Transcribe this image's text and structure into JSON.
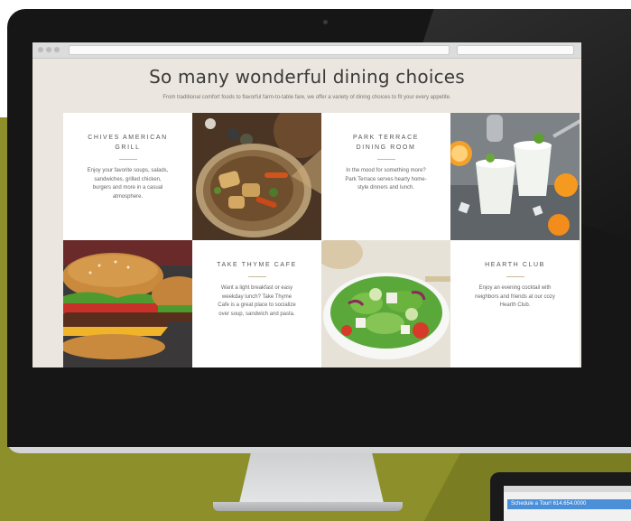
{
  "website": {
    "heading": "So many wonderful dining choices",
    "subheading": "From traditional comfort foods to flavorful farm-to-table fare, we offer a variety of dining choices to fit your every appetite."
  },
  "venues": [
    {
      "name": "CHIVES AMERICAN GRILL",
      "description": "Enjoy your favorite soups, salads, sandwiches, grilled chicken, burgers and more in a casual atmosphere."
    },
    {
      "name": "PARK TERRACE DINING ROOM",
      "description": "In the mood for something more? Park Terrace serves hearty home-style dinners and lunch."
    },
    {
      "name": "TAKE THYME CAFE",
      "description": "Want a light breakfast or easy weekday lunch? Take Thyme Cafe is a great place to socialize over soup, sandwich and pasta."
    },
    {
      "name": "HEARTH CLUB",
      "description": "Enjoy an evening cocktail with neighbors and friends at our cozy Hearth Club."
    }
  ],
  "images": [
    {
      "icon": "stew-dish-image"
    },
    {
      "icon": "cocktails-image"
    },
    {
      "icon": "burger-image"
    },
    {
      "icon": "salad-image"
    }
  ],
  "second_device": {
    "banner": "Schedule a Tour! 614.654.0000"
  },
  "colors": {
    "background_olive": "#8c8f2a",
    "bezel": "#161616",
    "page_bg": "#ebe6df",
    "accent_rule": "#c9b99a"
  }
}
